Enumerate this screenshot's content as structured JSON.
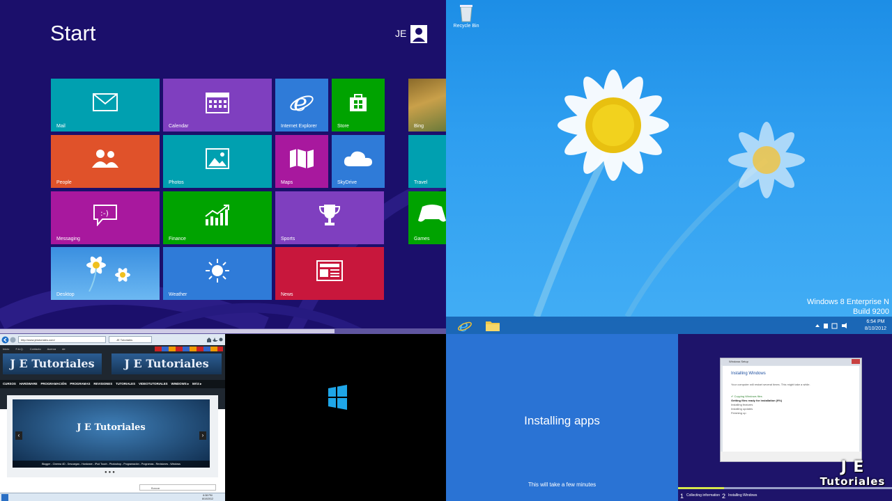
{
  "start_screen": {
    "title": "Start",
    "user_initials": "JE",
    "tiles": {
      "mail": "Mail",
      "calendar": "Calendar",
      "ie": "Internet Explorer",
      "store": "Store",
      "people": "People",
      "photos": "Photos",
      "maps": "Maps",
      "skydrive": "SkyDrive",
      "messaging": "Messaging",
      "finance": "Finance",
      "sports": "Sports",
      "desktop": "Desktop",
      "weather": "Weather",
      "news": "News",
      "bing": "Bing",
      "travel": "Travel",
      "games": "Games"
    },
    "colors": {
      "bg": "#1b0f6b",
      "teal": "#00a0b0",
      "purple": "#7f3fbf",
      "blue": "#2f7bd8",
      "green": "#00a300",
      "orange": "#e0522a",
      "magenta": "#a8189e",
      "red": "#c8173c"
    }
  },
  "desktop": {
    "recycle_bin": "Recycle Bin",
    "edition": "Windows 8 Enterprise N",
    "build": "Build 9200",
    "time": "6:54 PM",
    "date": "8/10/2012"
  },
  "browser": {
    "url": "http://www.jetutoriales.com/",
    "tab": "JE Tutoriales",
    "toplinks": [
      "Inicio",
      "F.A.Q.",
      "Contacto",
      "Acerca de"
    ],
    "logo": "J E Tutoriales",
    "nav": [
      "CURSOS",
      "HARDWARE",
      "PROGRAMACIÓN",
      "PROGRAMAS",
      "REVISIONES",
      "TUTORIALES",
      "VIDEOTUTORIALES",
      "WINDOWS ▸",
      "MÁS ▸"
    ],
    "banner_caption": "Blogger - Cinema 4D - Descargas - Hardware - iPod Touch - Photoshop - Programación - Programas - Revisiones - Windows",
    "search_label": "Buscar",
    "time": "6:38 PM",
    "date": "8/10/2012"
  },
  "installing": {
    "main": "Installing apps",
    "sub": "This will take a few minutes"
  },
  "setup": {
    "window_title": "Windows Setup",
    "heading": "Installing Windows",
    "desc": "Your computer will restart several times. This might take a while.",
    "steps": [
      "Copying Windows files",
      "Getting files ready for installation (9%)",
      "Installing features",
      "Installing updates",
      "Finishing up"
    ],
    "bottom_steps": [
      {
        "num": "1",
        "label": "Collecting information"
      },
      {
        "num": "2",
        "label": "Installing Windows"
      }
    ],
    "brand_line1": "J E",
    "brand_line2": "Tutoriales"
  }
}
